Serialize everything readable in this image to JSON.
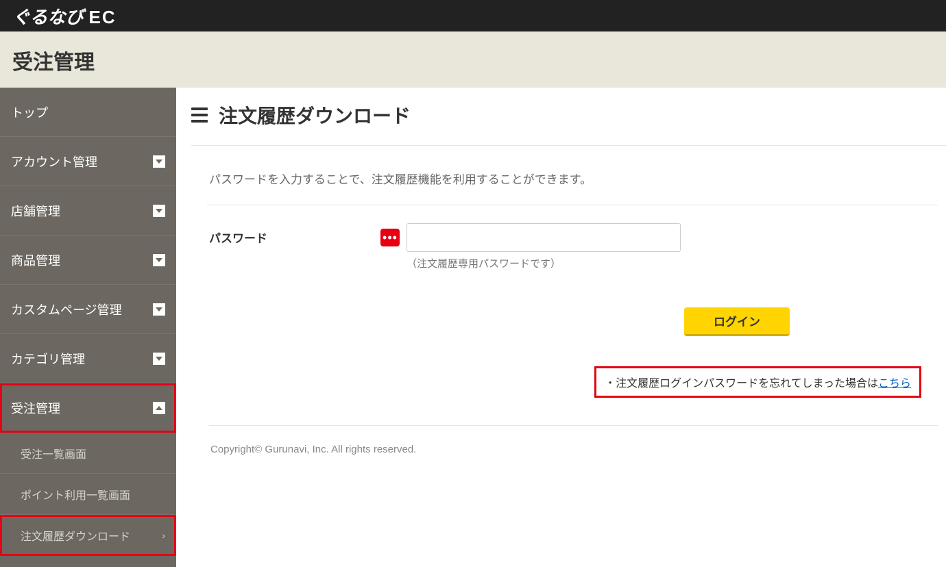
{
  "topbar": {
    "brand_main": "ぐるなび",
    "brand_suffix": "EC"
  },
  "section_title": "受注管理",
  "sidebar": {
    "items": [
      {
        "label": "トップ",
        "expandable": false
      },
      {
        "label": "アカウント管理",
        "expandable": true,
        "open": false
      },
      {
        "label": "店舗管理",
        "expandable": true,
        "open": false
      },
      {
        "label": "商品管理",
        "expandable": true,
        "open": false
      },
      {
        "label": "カスタムページ管理",
        "expandable": true,
        "open": false
      },
      {
        "label": "カテゴリ管理",
        "expandable": true,
        "open": false
      },
      {
        "label": "受注管理",
        "expandable": true,
        "open": true,
        "highlighted": true
      }
    ],
    "sub_items": [
      {
        "label": "受注一覧画面"
      },
      {
        "label": "ポイント利用一覧画面"
      },
      {
        "label": "注文履歴ダウンロード",
        "highlighted": true,
        "chevron": "›"
      }
    ]
  },
  "content": {
    "title": "注文履歴ダウンロード",
    "description": "パスワードを入力することで、注文履歴機能を利用することができます。",
    "password_label": "パスワード",
    "required_badge": "•••",
    "password_hint": "（注文履歴専用パスワードです）",
    "login_button": "ログイン",
    "forgot_prefix": "・注文履歴ログインパスワードを忘れてしまった場合は",
    "forgot_link": "こちら"
  },
  "footer": {
    "copyright": "Copyright© Gurunavi, Inc. All rights reserved."
  }
}
